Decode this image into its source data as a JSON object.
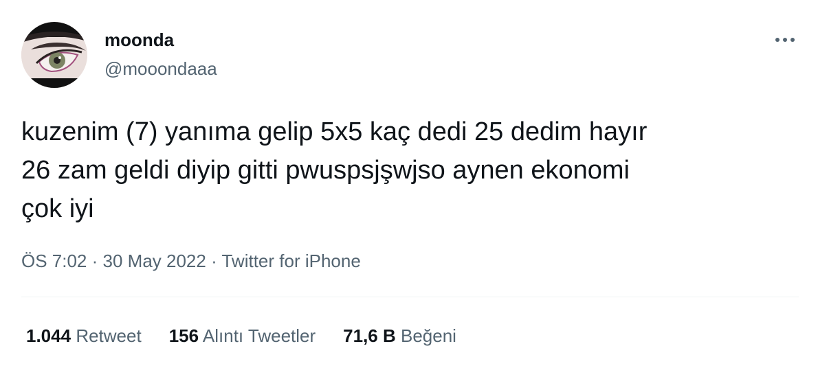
{
  "author": {
    "display_name": "moonda",
    "handle": "@mooondaaa",
    "avatar_icon": "avatar-eye-closeup"
  },
  "more_icon": "more-horizontal-icon",
  "tweet": {
    "text": "kuzenim (7) yanıma gelip 5x5 kaç dedi 25 dedim hayır\n26 zam geldi diyip gitti pwuspsjşwjso aynen ekonomi\nçok iyi"
  },
  "meta": {
    "time": "ÖS 7:02",
    "separator1": " · ",
    "date": "30 May 2022",
    "separator2": " · ",
    "source": "Twitter for iPhone"
  },
  "stats": [
    {
      "count": "1.044",
      "label": "Retweet"
    },
    {
      "count": "156",
      "label": "Alıntı Tweetler"
    },
    {
      "count": "71,6 B",
      "label": "Beğeni"
    }
  ],
  "colors": {
    "text_primary": "#0f1419",
    "text_secondary": "#536471",
    "divider": "#eff3f4"
  }
}
